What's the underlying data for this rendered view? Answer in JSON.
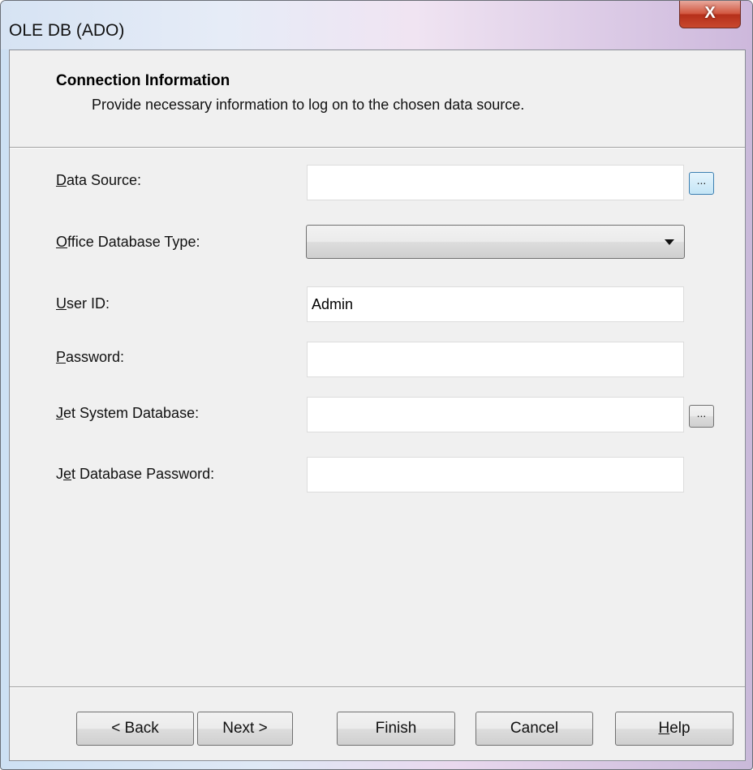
{
  "window": {
    "title": "OLE DB (ADO)",
    "close_glyph": "X"
  },
  "header": {
    "title": "Connection Information",
    "subtitle": "Provide necessary information to log on to the chosen data source."
  },
  "fields": {
    "data_source": {
      "label_mnemonic": "D",
      "label_rest": "ata Source:",
      "value": ""
    },
    "office_db_type": {
      "label_mnemonic": "O",
      "label_rest": "ffice Database Type:",
      "selected": ""
    },
    "user_id": {
      "label_mnemonic": "U",
      "label_rest": "ser ID:",
      "value": "Admin"
    },
    "password": {
      "label_mnemonic": "P",
      "label_rest": "assword:",
      "value": ""
    },
    "jet_system_db": {
      "label_mnemonic": "J",
      "label_rest": "et System Database:",
      "value": ""
    },
    "jet_db_password": {
      "label_pre": "J",
      "label_mnemonic": "e",
      "label_rest": "t Database Password:",
      "value": ""
    }
  },
  "browse_label": "...",
  "buttons": {
    "back": "< Back",
    "next": "Next >",
    "finish": "Finish",
    "cancel": "Cancel",
    "help_mnemonic": "H",
    "help_rest": "elp"
  }
}
